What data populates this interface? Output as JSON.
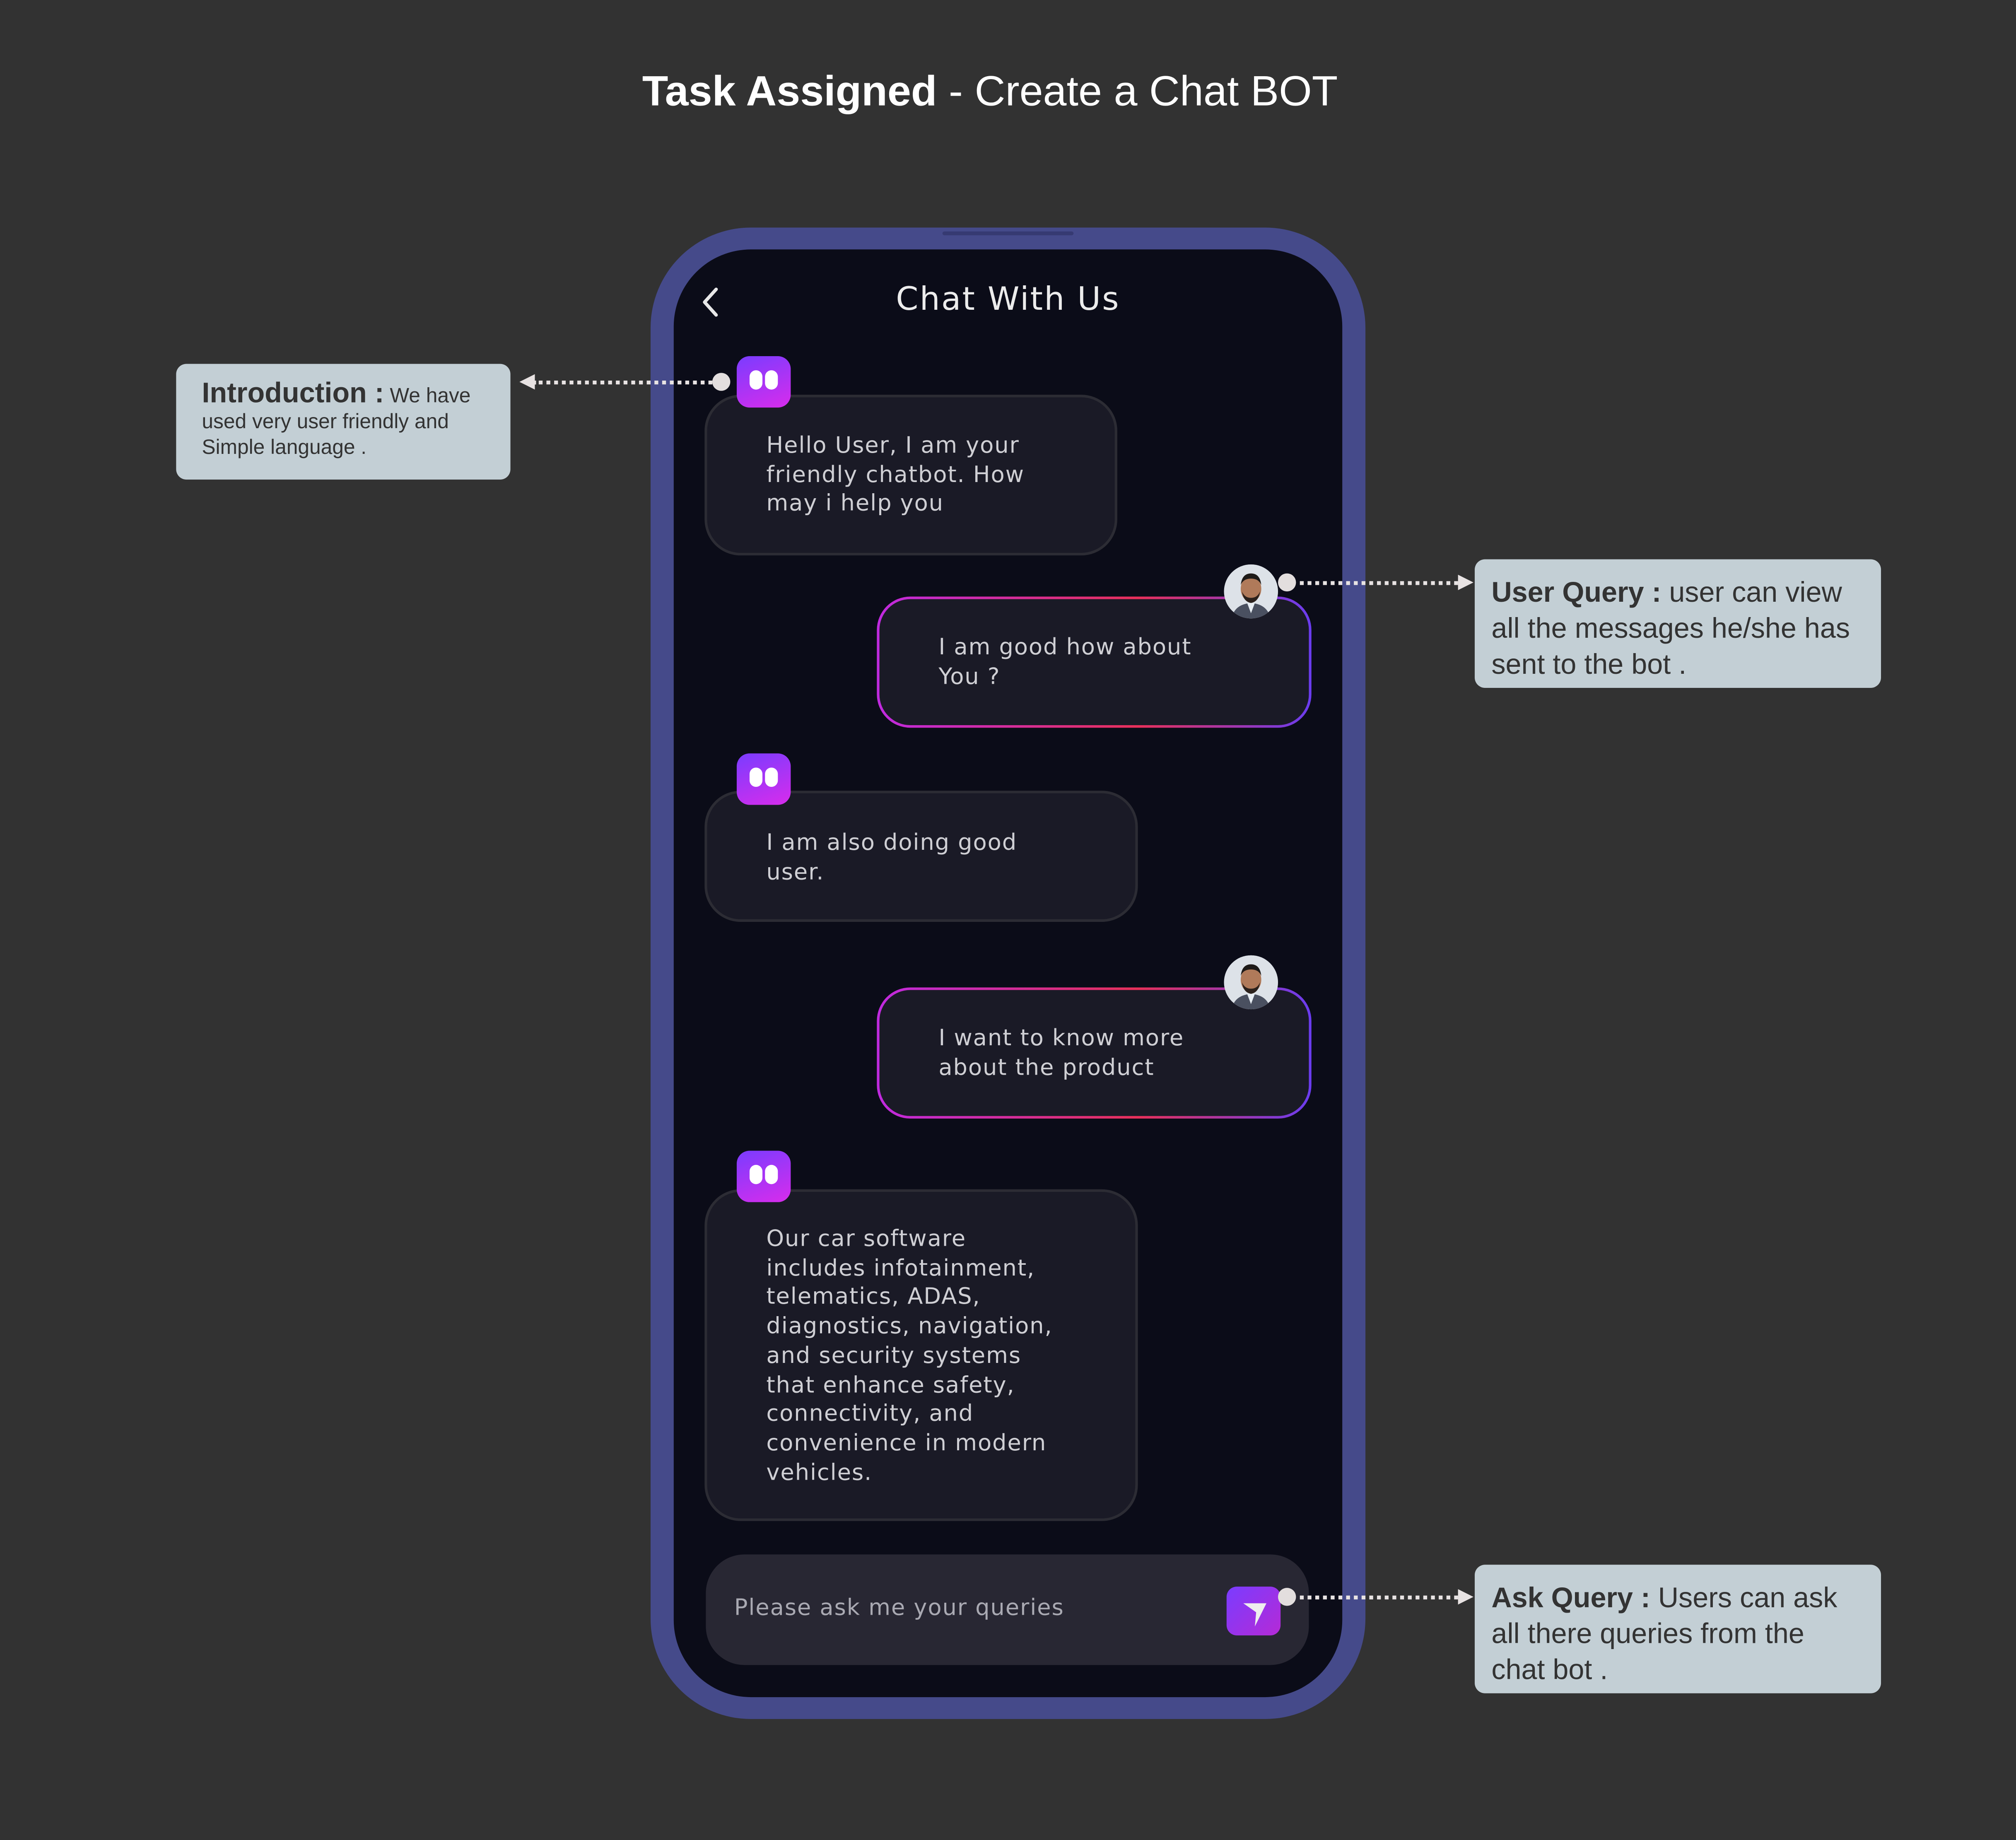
{
  "title": {
    "bold": "Task Assigned",
    "rest": " - Create a Chat BOT"
  },
  "app": {
    "header_title": "Chat With Us",
    "messages": [
      {
        "sender": "bot",
        "text": "Hello User, I am your\nfriendly chatbot. How\nmay i help you"
      },
      {
        "sender": "user",
        "text": "I am good how about\nYou ?"
      },
      {
        "sender": "bot",
        "text": "I am also doing good\nuser."
      },
      {
        "sender": "user",
        "text": "I want to know more\nabout the product"
      },
      {
        "sender": "bot",
        "text": "Our car software\nincludes infotainment,\ntelematics, ADAS,\ndiagnostics, navigation,\nand security systems\nthat enhance safety,\nconnectivity, and\nconvenience in modern\nvehicles."
      }
    ],
    "input_placeholder": "Please ask me your queries",
    "accent_gradient": [
      "#7a3cff",
      "#d82cec"
    ]
  },
  "annotations": {
    "intro": {
      "label": "Introduction :",
      "text1": " We have",
      "text2": "used very user friendly and",
      "text3": "Simple language ."
    },
    "user_query": {
      "label": "User Query :",
      "text": " user can view all the messages he/she has sent to the bot ."
    },
    "ask_query": {
      "label": "Ask Query :",
      "text": " Users can ask all there queries from the chat bot ."
    }
  }
}
